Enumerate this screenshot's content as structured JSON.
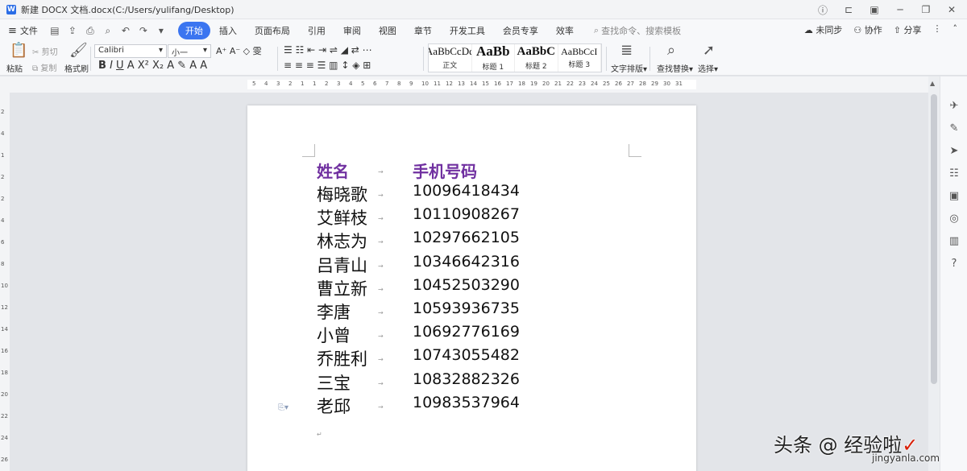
{
  "window": {
    "title": "新建 DOCX 文档.docx(C:/Users/yulifang/Desktop)",
    "app_icon": "W"
  },
  "menubar": {
    "file_label": "文件",
    "tabs": [
      "开始",
      "插入",
      "页面布局",
      "引用",
      "审阅",
      "视图",
      "章节",
      "开发工具",
      "会员专享",
      "效率"
    ],
    "active_tab": "开始",
    "search_placeholder": "查找命令、搜索模板",
    "sync_label": "未同步",
    "collab_label": "协作",
    "share_label": "分享"
  },
  "ribbon": {
    "paste_label": "粘贴",
    "cut_label": "剪切",
    "copy_label": "复制",
    "format_painter_label": "格式刷",
    "font_name": "Calibri",
    "font_size": "小一",
    "styles": [
      {
        "sample": "AaBbCcDd",
        "name": "正文"
      },
      {
        "sample": "AaBb",
        "name": "标题 1"
      },
      {
        "sample": "AaBbC",
        "name": "标题 2"
      },
      {
        "sample": "AaBbCcI",
        "name": "标题 3"
      }
    ],
    "text_layout_label": "文字排版",
    "find_replace_label": "查找替换",
    "select_label": "选择"
  },
  "ruler": {
    "top_ticks": [
      "5",
      "4",
      "3",
      "2",
      "1",
      "1",
      "2",
      "3",
      "4",
      "5",
      "6",
      "7",
      "8",
      "9",
      "10",
      "11",
      "12",
      "13",
      "14",
      "15",
      "16",
      "17",
      "18",
      "19",
      "20",
      "21",
      "22",
      "23",
      "24",
      "25",
      "26",
      "27",
      "28",
      "29",
      "30",
      "31"
    ],
    "left_ticks": [
      "2",
      "4",
      "1",
      "2",
      "2",
      "4",
      "6",
      "8",
      "10",
      "12",
      "14",
      "16",
      "18",
      "20",
      "22",
      "24",
      "26"
    ]
  },
  "document": {
    "header": {
      "name": "姓名",
      "phone": "手机号码"
    },
    "rows": [
      {
        "name": "梅晓歌",
        "phone": "10096418434"
      },
      {
        "name": "艾鲜枝",
        "phone": "10110908267"
      },
      {
        "name": "林志为",
        "phone": "10297662105"
      },
      {
        "name": "吕青山",
        "phone": "10346642316"
      },
      {
        "name": "曹立新",
        "phone": "10452503290"
      },
      {
        "name": "李唐",
        "phone": "10593936735"
      },
      {
        "name": "小曾",
        "phone": "10692776169"
      },
      {
        "name": "乔胜利",
        "phone": "10743055482"
      },
      {
        "name": "三宝",
        "phone": "10832882326"
      },
      {
        "name": "老邱",
        "phone": "10983537964"
      }
    ],
    "header_color": "#7030a0"
  },
  "watermark": {
    "line1": "头条 @ 经验啦",
    "check": "✓",
    "line2": "jingyanla.com"
  }
}
